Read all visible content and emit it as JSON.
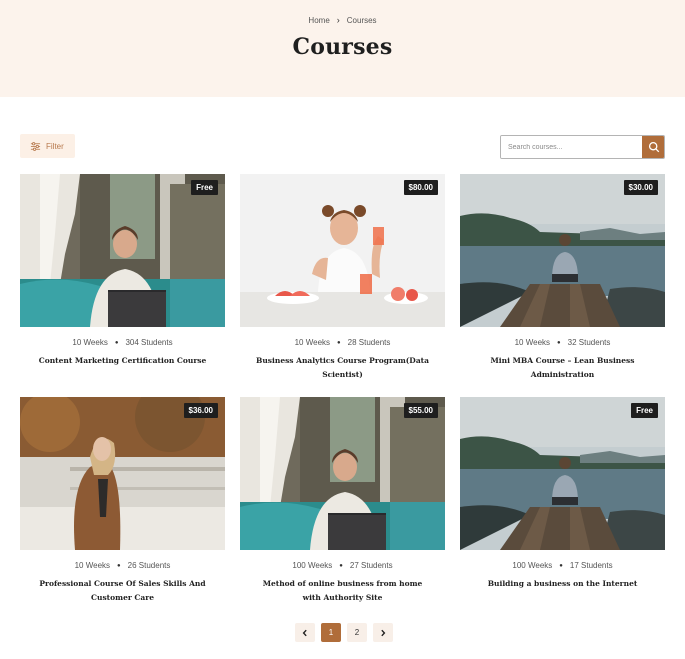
{
  "breadcrumb": {
    "home": "Home",
    "current": "Courses"
  },
  "page_title": "Courses",
  "toolbar": {
    "filter_label": "Filter",
    "search_placeholder": "Search courses..."
  },
  "courses": [
    {
      "price": "Free",
      "weeks": "10 Weeks",
      "students": "304 Students",
      "title": "Content Marketing Certification Course",
      "image": "laptop"
    },
    {
      "price": "$80.00",
      "weeks": "10 Weeks",
      "students": "28 Students",
      "title": "Business Analytics Course Program(Data Scientist)",
      "image": "breakfast"
    },
    {
      "price": "$30.00",
      "weeks": "10 Weeks",
      "students": "32 Students",
      "title": "Mini MBA Course – Lean Business Administration",
      "image": "lake"
    },
    {
      "price": "$36.00",
      "weeks": "10 Weeks",
      "students": "26 Students",
      "title": "Professional Course Of Sales Skills And Customer Care",
      "image": "autumn"
    },
    {
      "price": "$55.00",
      "weeks": "100 Weeks",
      "students": "27 Students",
      "title": "Method of online business from home with Authority Site",
      "image": "laptop"
    },
    {
      "price": "Free",
      "weeks": "100 Weeks",
      "students": "17 Students",
      "title": "Building a business on the Internet",
      "image": "lake"
    }
  ],
  "pagination": {
    "pages": [
      "1",
      "2"
    ],
    "active": "1"
  },
  "colors": {
    "accent": "#b06d3a",
    "hero_bg": "#fcf3ec",
    "badge_bg": "#1e1e1e"
  }
}
